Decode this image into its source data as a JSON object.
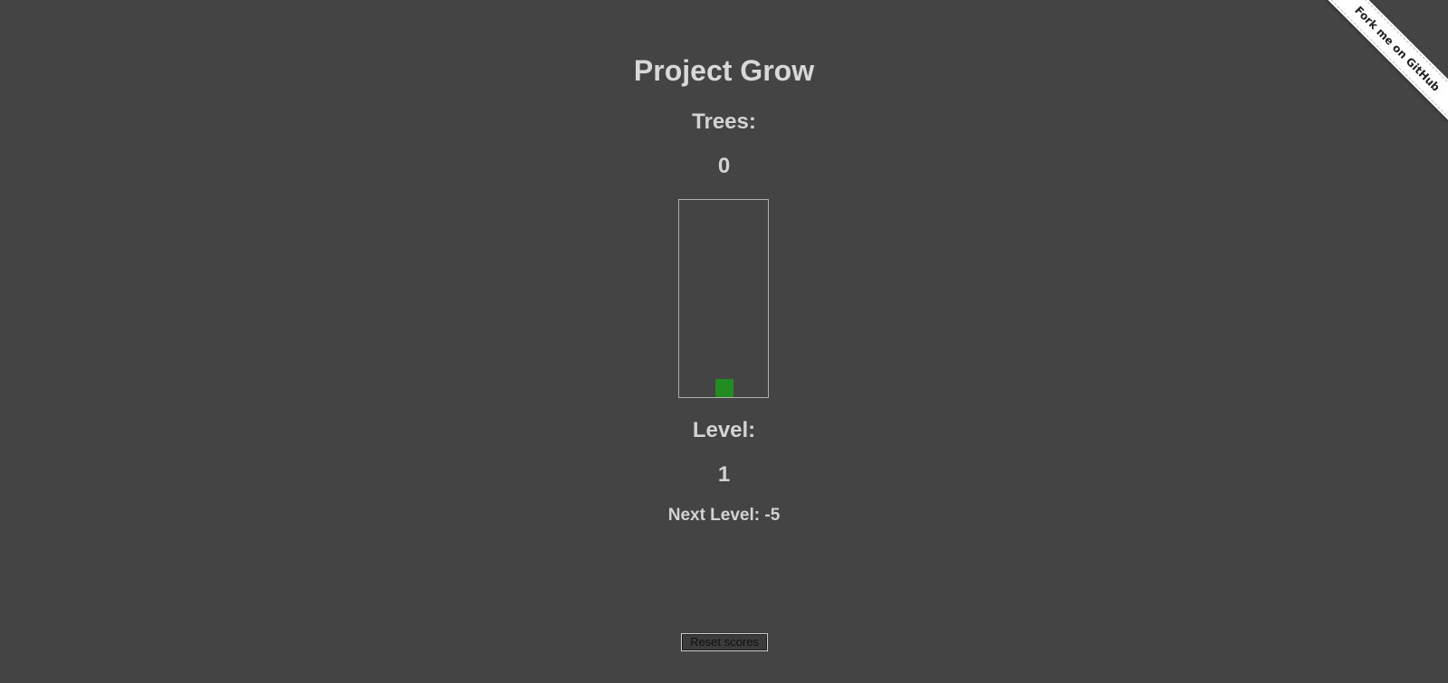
{
  "title": "Project Grow",
  "trees": {
    "label": "Trees:",
    "value": "0"
  },
  "game": {
    "tree_color": "#228b22",
    "border_color": "#b0b0b0"
  },
  "level": {
    "label": "Level:",
    "value": "1"
  },
  "next_level": {
    "text": "Next Level: -5"
  },
  "reset_button": {
    "label": "Reset scores"
  },
  "ribbon": {
    "label": "Fork me on GitHub"
  },
  "colors": {
    "background": "#444444",
    "text": "#d3d3d3"
  }
}
